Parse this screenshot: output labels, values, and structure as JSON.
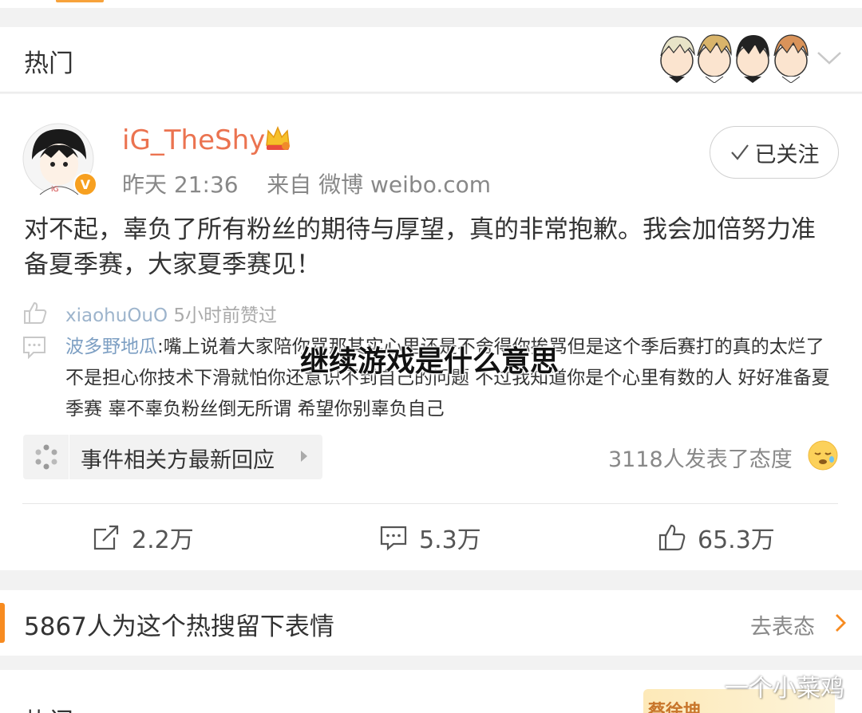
{
  "hot_section": {
    "title": "热门",
    "banner_icon": "four-anime-faces-banner",
    "collapse_icon": "chevron-down-icon"
  },
  "post": {
    "username": "iG_TheShy",
    "badge_icon": "vip-crown-icon",
    "verified_icon": "verified-v-badge-icon",
    "timestamp": "昨天 21:36",
    "source": "来自 微博 weibo.com",
    "follow_label": "已关注",
    "text": "对不起，辜负了所有粉丝的期待与厚望，真的非常抱歉。我会加倍努力准备夏季赛，大家夏季赛见！",
    "liked_by": {
      "user": "xiaohuOuO",
      "text": " 5小时前赞过"
    },
    "top_comment": {
      "user": "波多野地瓜",
      "text": ":嘴上说着大家陪你骂那其实心里还是不舍得你挨骂但是这个季后赛打的真的太烂了不是担心你技术下滑就怕你还意识不到自己的问题 不过我知道你是个心里有数的人 好好准备夏季赛 辜不辜负粉丝倒无所谓 希望你别辜负自己"
    },
    "event_chip": {
      "label": "事件相关方最新回应"
    },
    "attitude": {
      "text": "3118人发表了态度",
      "emoji_icon": "sleepy-face-emoji"
    },
    "actions": {
      "repost": "2.2万",
      "comment": "5.3万",
      "like": "65.3万"
    }
  },
  "emote_section": {
    "title": "5867人为这个热搜留下表情",
    "link_label": "去表态"
  },
  "bottom_section": {
    "title": "热门",
    "banner_text": "蔡徐坤"
  },
  "overlay": {
    "title": "继续游戏是什么意思",
    "watermark": "一个小菜鸡"
  },
  "colors": {
    "username": "#eb7350",
    "link_user": "#7d9fc3",
    "accent": "#f78b20",
    "background": "#f2f2f2"
  }
}
